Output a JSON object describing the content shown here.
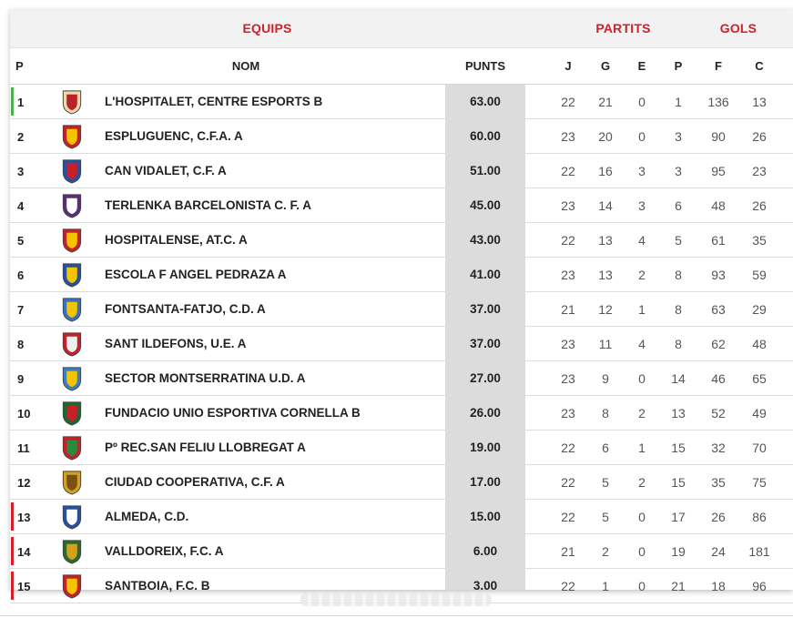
{
  "groups": {
    "equips": "EQUIPS",
    "partits": "PARTITS",
    "gols": "GOLS"
  },
  "headers": {
    "p": "P",
    "nom": "NOM",
    "punts": "PUNTS",
    "j": "J",
    "g": "G",
    "e": "E",
    "pl": "P",
    "f": "F",
    "c": "C"
  },
  "colors": {
    "accent": "#d0202a",
    "promotion": "#4caf50",
    "relegation": "#d0202a"
  },
  "rows": [
    {
      "pos": "1",
      "team": "L'HOSPITALET, CENTRE ESPORTS B",
      "pts": "63.00",
      "j": "22",
      "g": "21",
      "e": "0",
      "p": "1",
      "f": "136",
      "c": "13",
      "zone": "promotion"
    },
    {
      "pos": "2",
      "team": "ESPLUGUENC, C.F.A. A",
      "pts": "60.00",
      "j": "23",
      "g": "20",
      "e": "0",
      "p": "3",
      "f": "90",
      "c": "26",
      "zone": ""
    },
    {
      "pos": "3",
      "team": "CAN VIDALET, C.F. A",
      "pts": "51.00",
      "j": "22",
      "g": "16",
      "e": "3",
      "p": "3",
      "f": "95",
      "c": "23",
      "zone": ""
    },
    {
      "pos": "4",
      "team": "TERLENKA BARCELONISTA C. F. A",
      "pts": "45.00",
      "j": "23",
      "g": "14",
      "e": "3",
      "p": "6",
      "f": "48",
      "c": "26",
      "zone": ""
    },
    {
      "pos": "5",
      "team": "HOSPITALENSE, AT.C. A",
      "pts": "43.00",
      "j": "22",
      "g": "13",
      "e": "4",
      "p": "5",
      "f": "61",
      "c": "35",
      "zone": ""
    },
    {
      "pos": "6",
      "team": "ESCOLA F ANGEL PEDRAZA A",
      "pts": "41.00",
      "j": "23",
      "g": "13",
      "e": "2",
      "p": "8",
      "f": "93",
      "c": "59",
      "zone": ""
    },
    {
      "pos": "7",
      "team": "FONTSANTA-FATJO, C.D. A",
      "pts": "37.00",
      "j": "21",
      "g": "12",
      "e": "1",
      "p": "8",
      "f": "63",
      "c": "29",
      "zone": ""
    },
    {
      "pos": "8",
      "team": "SANT ILDEFONS, U.E. A",
      "pts": "37.00",
      "j": "23",
      "g": "11",
      "e": "4",
      "p": "8",
      "f": "62",
      "c": "48",
      "zone": ""
    },
    {
      "pos": "9",
      "team": "SECTOR MONTSERRATINA U.D. A",
      "pts": "27.00",
      "j": "23",
      "g": "9",
      "e": "0",
      "p": "14",
      "f": "46",
      "c": "65",
      "zone": ""
    },
    {
      "pos": "10",
      "team": "FUNDACIO UNIO ESPORTIVA CORNELLA B",
      "pts": "26.00",
      "j": "23",
      "g": "8",
      "e": "2",
      "p": "13",
      "f": "52",
      "c": "49",
      "zone": ""
    },
    {
      "pos": "11",
      "team": "Pº REC.SAN FELIU LLOBREGAT A",
      "pts": "19.00",
      "j": "22",
      "g": "6",
      "e": "1",
      "p": "15",
      "f": "32",
      "c": "70",
      "zone": ""
    },
    {
      "pos": "12",
      "team": "CIUDAD COOPERATIVA, C.F. A",
      "pts": "17.00",
      "j": "22",
      "g": "5",
      "e": "2",
      "p": "15",
      "f": "35",
      "c": "75",
      "zone": ""
    },
    {
      "pos": "13",
      "team": "ALMEDA, C.D.",
      "pts": "15.00",
      "j": "22",
      "g": "5",
      "e": "0",
      "p": "17",
      "f": "26",
      "c": "86",
      "zone": "relegation"
    },
    {
      "pos": "14",
      "team": "VALLDOREIX, F.C. A",
      "pts": "6.00",
      "j": "21",
      "g": "2",
      "e": "0",
      "p": "19",
      "f": "24",
      "c": "181",
      "zone": "relegation"
    },
    {
      "pos": "15",
      "team": "SANTBOIA, F.C. B",
      "pts": "3.00",
      "j": "22",
      "g": "1",
      "e": "0",
      "p": "21",
      "f": "18",
      "c": "96",
      "zone": "relegation"
    }
  ]
}
